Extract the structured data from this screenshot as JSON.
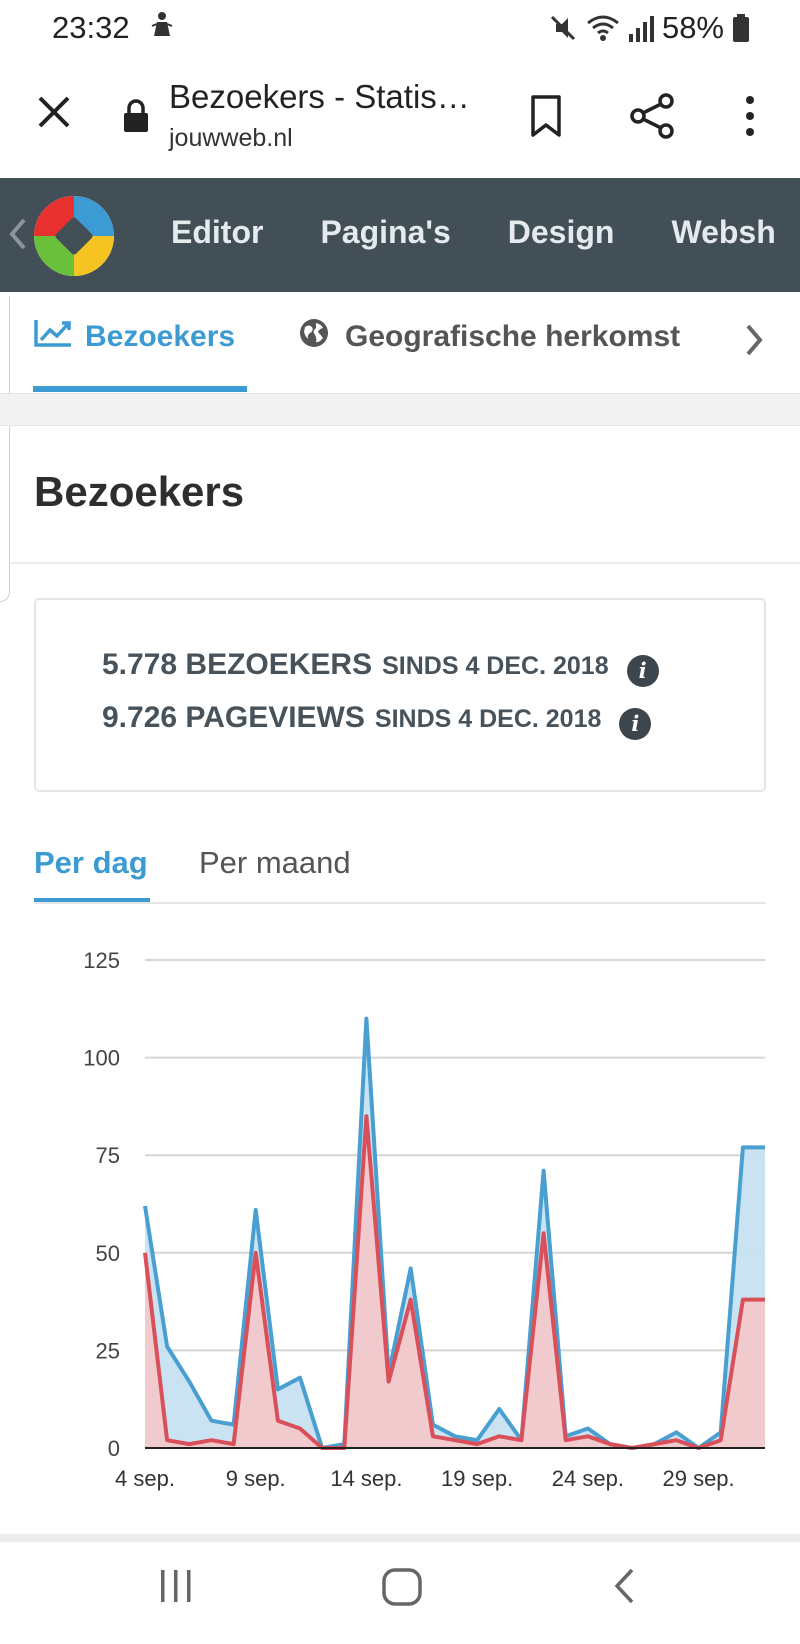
{
  "status_bar": {
    "time": "23:32",
    "battery": "58%",
    "icons": [
      "notification-person-icon",
      "mute-icon",
      "wifi-icon",
      "signal-icon",
      "battery-icon"
    ]
  },
  "browser": {
    "title": "Bezoekers - Statis…",
    "url": "jouwweb.nl",
    "icons": [
      "close-icon",
      "lock-icon",
      "bookmark-icon",
      "share-icon",
      "more-vert-icon"
    ]
  },
  "app_nav": {
    "items": [
      "Editor",
      "Pagina's",
      "Design",
      "Websh"
    ],
    "colors": {
      "background": "#434f57",
      "text": "#e5eaee"
    }
  },
  "subtabs": {
    "items": [
      {
        "label": "Bezoekers",
        "icon": "line-chart-icon",
        "active": true
      },
      {
        "label": "Geografische herkomst",
        "icon": "globe-icon",
        "active": false
      }
    ],
    "accent": "#3d9bd4"
  },
  "page": {
    "title": "Bezoekers"
  },
  "stats": {
    "visitors": {
      "value": "5.778 BEZOEKERS",
      "since": "SINDS 4 DEC. 2018",
      "info": "i"
    },
    "pageviews": {
      "value": "9.726 PAGEVIEWS",
      "since": "SINDS 4 DEC. 2018",
      "info": "i"
    }
  },
  "period_tabs": {
    "active": "Per dag",
    "other": "Per maand"
  },
  "chart_data": {
    "type": "area",
    "ylim": [
      0,
      125
    ],
    "yticks": [
      0,
      25,
      50,
      75,
      100,
      125
    ],
    "xtick_labels": [
      "4 sep.",
      "9 sep.",
      "14 sep.",
      "19 sep.",
      "24 sep.",
      "29 sep."
    ],
    "x": [
      "4 sep.",
      "5 sep.",
      "6 sep.",
      "7 sep.",
      "8 sep.",
      "9 sep.",
      "10 sep.",
      "11 sep.",
      "12 sep.",
      "13 sep.",
      "14 sep.",
      "15 sep.",
      "16 sep.",
      "17 sep.",
      "18 sep.",
      "19 sep.",
      "20 sep.",
      "21 sep.",
      "22 sep.",
      "23 sep.",
      "24 sep.",
      "25 sep.",
      "26 sep.",
      "27 sep.",
      "28 sep.",
      "29 sep.",
      "30 sep.",
      "1 okt.",
      "2 okt."
    ],
    "series": [
      {
        "color": "#4a9fd1",
        "fill": "#c6e1f2",
        "values": [
          62,
          26,
          17,
          7,
          6,
          61,
          15,
          18,
          0,
          1,
          110,
          19,
          46,
          6,
          3,
          2,
          10,
          2,
          71,
          3,
          5,
          1,
          0,
          1,
          4,
          0,
          4,
          77,
          77
        ]
      },
      {
        "color": "#d9505a",
        "fill": "#f5c6ca",
        "values": [
          50,
          2,
          1,
          2,
          1,
          50,
          7,
          5,
          0,
          0,
          85,
          17,
          38,
          3,
          2,
          1,
          3,
          2,
          55,
          2,
          3,
          1,
          0,
          1,
          2,
          0,
          2,
          38,
          38
        ]
      }
    ],
    "grid": true,
    "legend": "none"
  },
  "android_nav": {
    "icons": [
      "recent-apps-icon",
      "home-icon",
      "back-icon"
    ]
  }
}
